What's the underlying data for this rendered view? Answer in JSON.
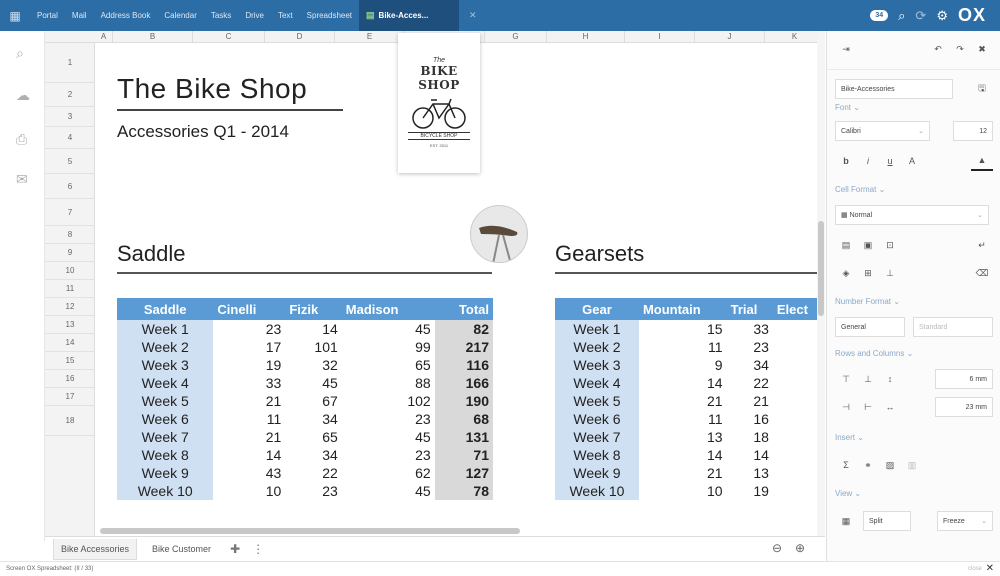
{
  "topbar": {
    "tabs": [
      "Portal",
      "Mail",
      "Address Book",
      "Calendar",
      "Tasks",
      "Drive",
      "Text",
      "Spreadsheet"
    ],
    "active_tab": "Bike-Acces...",
    "badge": "34",
    "logo": "OX"
  },
  "sheet": {
    "columns": [
      "A",
      "B",
      "C",
      "D",
      "E",
      "F",
      "G",
      "H",
      "I",
      "J",
      "K"
    ],
    "rows": [
      "1",
      "2",
      "3",
      "4",
      "5",
      "6",
      "7",
      "8",
      "9",
      "10",
      "11",
      "12",
      "13",
      "14",
      "15",
      "16",
      "17",
      "18"
    ],
    "title": "The Bike Shop",
    "subtitle": "Accessories Q1 - 2014",
    "logo": {
      "the": "The",
      "name": "BIKE SHOP",
      "sub": "BICYCLE SHOP",
      "small": "EST. 2011"
    },
    "saddle": {
      "title": "Saddle",
      "headers": [
        "Saddle",
        "Cinelli",
        "Fizik",
        "Madison",
        "Total"
      ],
      "rows": [
        [
          "Week 1",
          "23",
          "14",
          "45",
          "82"
        ],
        [
          "Week 2",
          "17",
          "101",
          "99",
          "217"
        ],
        [
          "Week 3",
          "19",
          "32",
          "65",
          "116"
        ],
        [
          "Week 4",
          "33",
          "45",
          "88",
          "166"
        ],
        [
          "Week 5",
          "21",
          "67",
          "102",
          "190"
        ],
        [
          "Week 6",
          "11",
          "34",
          "23",
          "68"
        ],
        [
          "Week 7",
          "21",
          "65",
          "45",
          "131"
        ],
        [
          "Week 8",
          "14",
          "34",
          "23",
          "71"
        ],
        [
          "Week 9",
          "43",
          "22",
          "62",
          "127"
        ],
        [
          "Week 10",
          "10",
          "23",
          "45",
          "78"
        ]
      ]
    },
    "gearsets": {
      "title": "Gearsets",
      "headers": [
        "Gear",
        "Mountain",
        "Trial",
        "Elect"
      ],
      "rows": [
        [
          "Week 1",
          "15",
          "33"
        ],
        [
          "Week 2",
          "11",
          "23"
        ],
        [
          "Week 3",
          "9",
          "34"
        ],
        [
          "Week 4",
          "14",
          "22"
        ],
        [
          "Week 5",
          "21",
          "21"
        ],
        [
          "Week 6",
          "11",
          "16"
        ],
        [
          "Week 7",
          "13",
          "18"
        ],
        [
          "Week 8",
          "14",
          "14"
        ],
        [
          "Week 9",
          "21",
          "13"
        ],
        [
          "Week 10",
          "10",
          "19"
        ]
      ]
    }
  },
  "bottom": {
    "tabs": [
      "Bike Accessories",
      "Bike Customer"
    ],
    "status": "Screen OX Spreadsheet: (II / 33)",
    "close_label": "close"
  },
  "panel": {
    "doc_name": "Bike-Accessories",
    "font_head": "Font",
    "font_name": "Calibri",
    "font_size": "12",
    "cell_format_head": "Cell Format",
    "cell_style": "Normal",
    "number_format_head": "Number Format",
    "number_format": "General",
    "number_sub": "Standard",
    "rows_cols_head": "Rows and Columns",
    "row_height": "6 mm",
    "col_width": "23 mm",
    "insert_head": "Insert",
    "view_head": "View",
    "split": "Split",
    "freeze": "Freeze"
  }
}
